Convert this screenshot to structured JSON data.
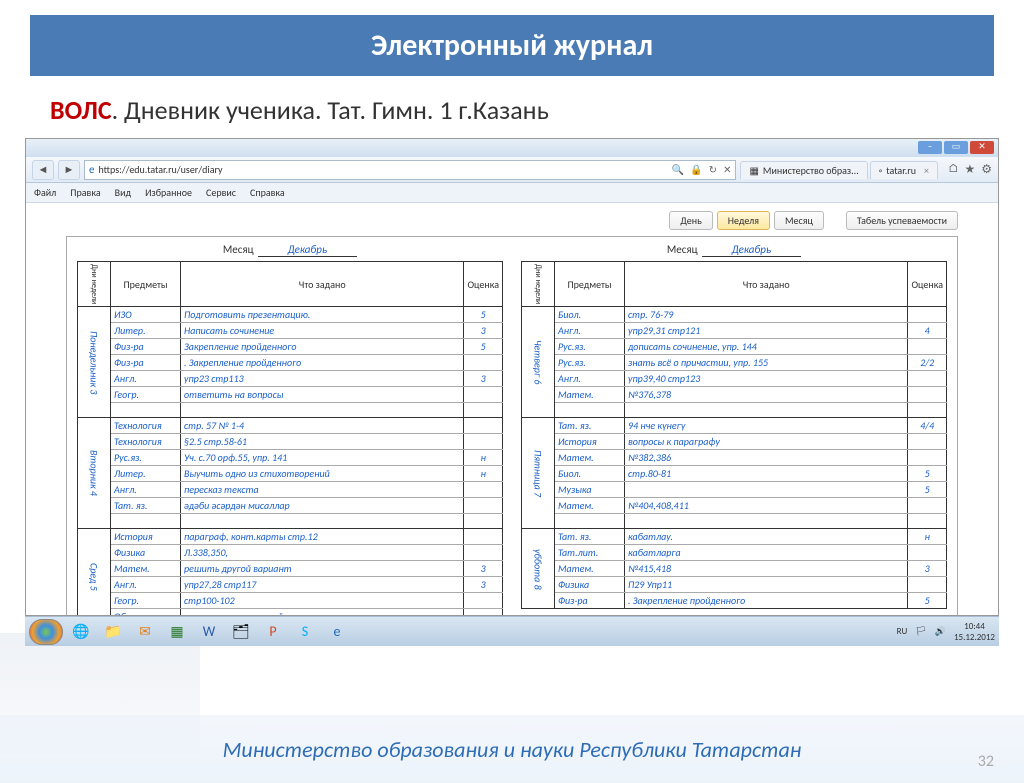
{
  "slide": {
    "title": "Электронный журнал",
    "sub_red": "ВОЛС",
    "sub_rest": ".  Дневник ученика. Тат. Гимн. 1  г.Казань",
    "footer": "Министерство образования и науки Республики Татарстан",
    "pagenum": "32"
  },
  "browser": {
    "url": "https://edu.tatar.ru/user/diary",
    "tab1": "Министерство образ...",
    "tab2": "tatar.ru",
    "menus": [
      "Файл",
      "Правка",
      "Вид",
      "Избранное",
      "Сервис",
      "Справка"
    ]
  },
  "controls": {
    "day": "День",
    "week": "Неделя",
    "month": "Месяц",
    "report": "Табель успеваемости"
  },
  "diary": {
    "month_label": "Месяц",
    "month_value": "Декабрь",
    "headers": {
      "day": "Дни недели",
      "subj": "Предметы",
      "task": "Что задано",
      "grade": "Оценка"
    },
    "left_days": [
      {
        "name": "Понедельник 3",
        "rows": [
          {
            "s": "ИЗО",
            "t": "Подготовить презентацию.",
            "g": "5"
          },
          {
            "s": "Литер.",
            "t": "Написать сочинение",
            "g": "3"
          },
          {
            "s": "Физ-ра",
            "t": "Закрепление пройденного",
            "g": "5"
          },
          {
            "s": "Физ-ра",
            "t": ". Закрепление пройденного",
            "g": ""
          },
          {
            "s": "Англ.",
            "t": "упр23 стр113",
            "g": "3"
          },
          {
            "s": "Геогр.",
            "t": "ответить на вопросы",
            "g": ""
          },
          {
            "s": "",
            "t": "",
            "g": ""
          }
        ]
      },
      {
        "name": "Вторник 4",
        "rows": [
          {
            "s": "Технология",
            "t": "стр. 57 № 1-4",
            "g": ""
          },
          {
            "s": "Технология",
            "t": "§2.5 стр.58-61",
            "g": ""
          },
          {
            "s": "Рус.яз.",
            "t": "Уч. с.70 орф.55, упр. 141",
            "g": "н"
          },
          {
            "s": "Литер.",
            "t": "Выучить одно из стихотворений",
            "g": "н"
          },
          {
            "s": "Англ.",
            "t": "пересказ текста",
            "g": ""
          },
          {
            "s": "Тат. яз.",
            "t": "әдәби әсәрдән мисаллар",
            "g": ""
          },
          {
            "s": "",
            "t": "",
            "g": ""
          }
        ]
      },
      {
        "name": "Сред 5",
        "rows": [
          {
            "s": "История",
            "t": "параграф, конт.карты стр.12",
            "g": ""
          },
          {
            "s": "Физика",
            "t": "Л.338,350,",
            "g": ""
          },
          {
            "s": "Матем.",
            "t": "решить другой вариант",
            "g": "3"
          },
          {
            "s": "Англ.",
            "t": "упр27,28 стр117",
            "g": "3"
          },
          {
            "s": "Геогр.",
            "t": "стр100-102",
            "g": ""
          },
          {
            "s": "Общест.",
            "t": "повторить изученный материал",
            "g": ""
          }
        ]
      }
    ],
    "right_days": [
      {
        "name": "Четверг 6",
        "rows": [
          {
            "s": "Биол.",
            "t": "стр. 76-79",
            "g": ""
          },
          {
            "s": "Англ.",
            "t": "упр29,31 стр121",
            "g": "4"
          },
          {
            "s": "Рус.яз.",
            "t": "дописать сочинение, упр. 144",
            "g": ""
          },
          {
            "s": "Рус.яз.",
            "t": "знать всё о причастии, упр. 155",
            "g": "2/2"
          },
          {
            "s": "Англ.",
            "t": "упр39,40 стр123",
            "g": ""
          },
          {
            "s": "Матем.",
            "t": "№376,378",
            "g": ""
          },
          {
            "s": "",
            "t": "",
            "g": ""
          }
        ]
      },
      {
        "name": "Пятница 7",
        "rows": [
          {
            "s": "Тат. яз.",
            "t": "94 нче күнегү",
            "g": "4/4"
          },
          {
            "s": "История",
            "t": "вопросы к параграфу",
            "g": ""
          },
          {
            "s": "Матем.",
            "t": "№382,386",
            "g": ""
          },
          {
            "s": "Биол.",
            "t": "стр.80-81",
            "g": "5"
          },
          {
            "s": "Музыка",
            "t": "",
            "g": "5"
          },
          {
            "s": "Матем.",
            "t": "№404,408,411",
            "g": ""
          },
          {
            "s": "",
            "t": "",
            "g": ""
          }
        ]
      },
      {
        "name": "уббота 8",
        "rows": [
          {
            "s": "Тат. яз.",
            "t": "кабатлау.",
            "g": "н"
          },
          {
            "s": "Тат.лит.",
            "t": "кабатларга",
            "g": ""
          },
          {
            "s": "Матем.",
            "t": "№415,418",
            "g": "3"
          },
          {
            "s": "Физика",
            "t": "П29 Упр11",
            "g": ""
          },
          {
            "s": "Физ-ра",
            "t": ". Закрепление пройденного",
            "g": "5"
          }
        ]
      }
    ]
  },
  "taskbar": {
    "lang": "RU",
    "time": "10:44",
    "date": "15.12.2012"
  }
}
